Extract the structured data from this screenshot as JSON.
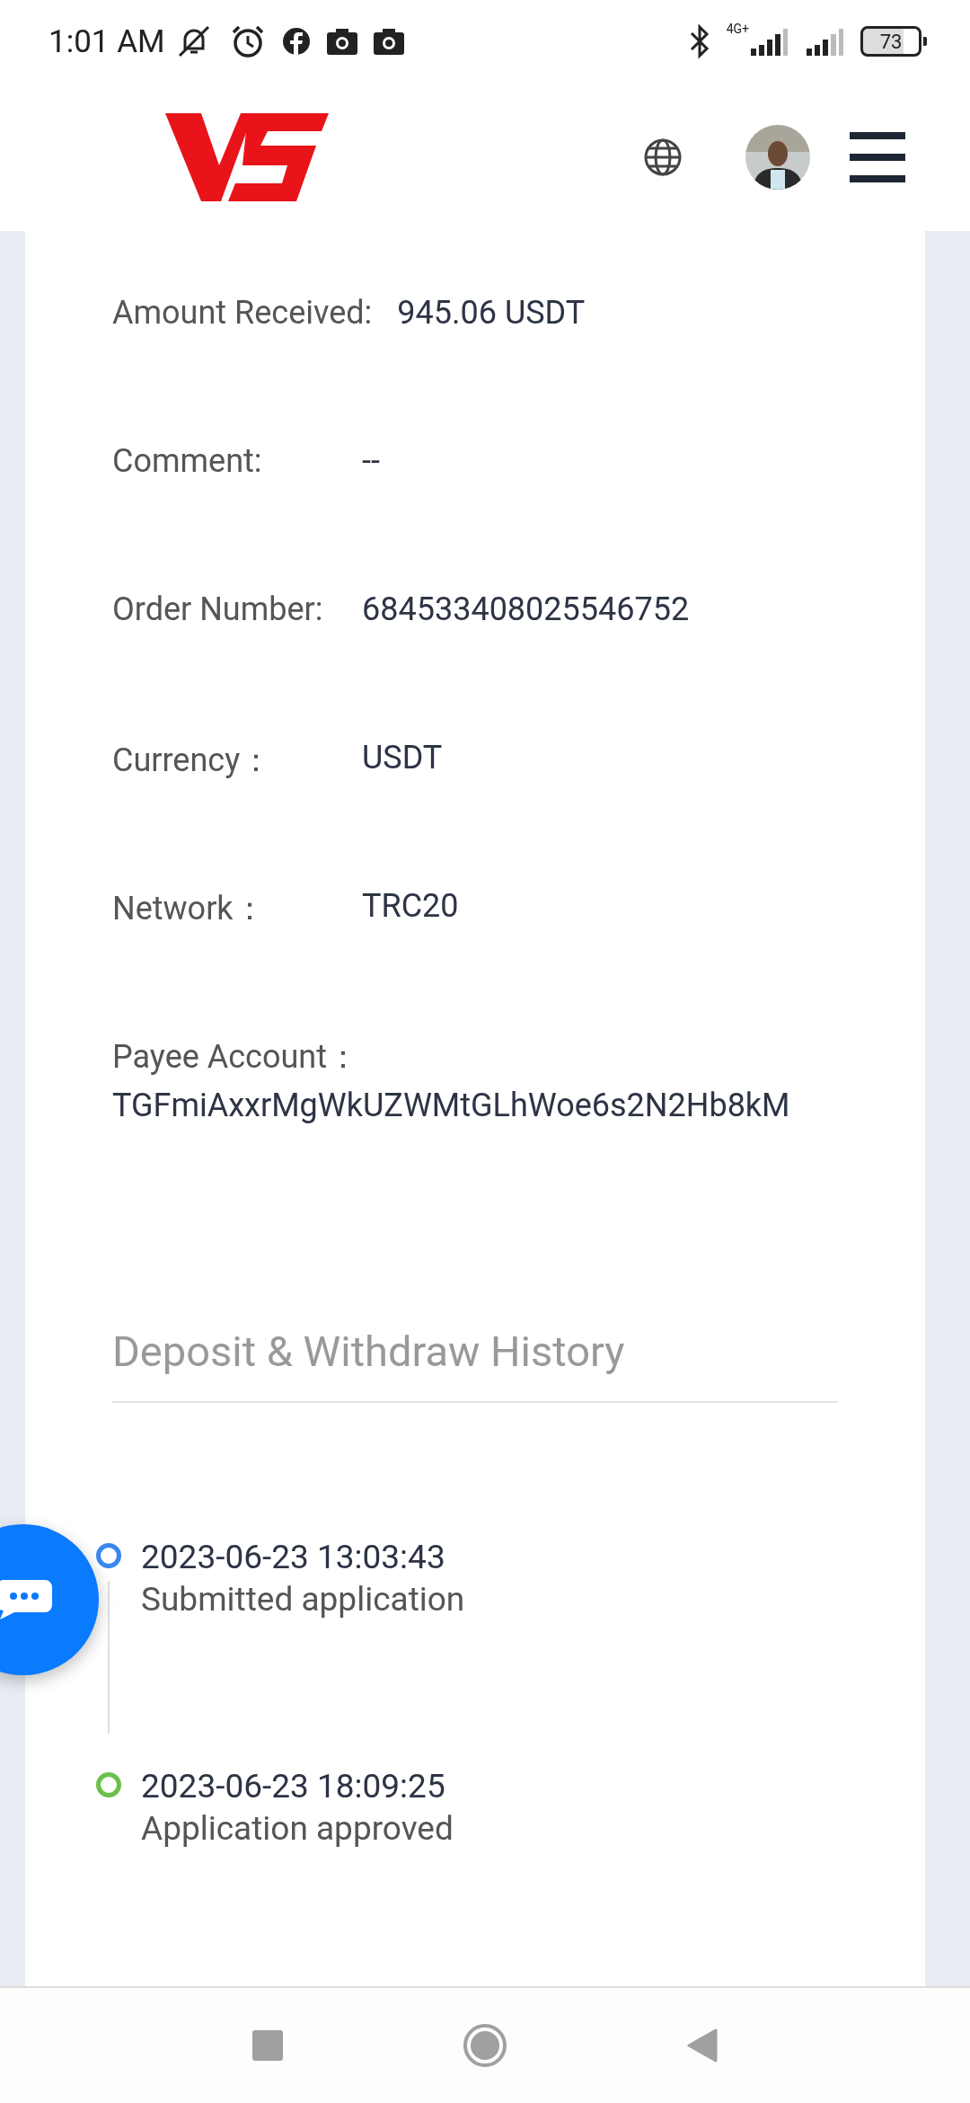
{
  "status_bar": {
    "time": "1:01 AM",
    "network": "4G+",
    "battery": "73"
  },
  "details": [
    {
      "label": "Amount Received:",
      "value": "945.06 USDT"
    },
    {
      "label": "Comment:",
      "value": "--"
    },
    {
      "label": "Order Number:",
      "value": "684533408025546752"
    },
    {
      "label": "Currency：",
      "value": "USDT"
    },
    {
      "label": "Network：",
      "value": "TRC20"
    }
  ],
  "payee": {
    "label": "Payee Account：",
    "value": "TGFmiAxxrMgWkUZWMtGLhWoe6s2N2Hb8kM"
  },
  "history": {
    "title": "Deposit & Withdraw History",
    "items": [
      {
        "time": "2023-06-23 13:03:43",
        "text": "Submitted application",
        "color": "#3a86ee"
      },
      {
        "time": "2023-06-23 18:09:25",
        "text": "Application approved",
        "color": "#6cc04a"
      }
    ]
  }
}
